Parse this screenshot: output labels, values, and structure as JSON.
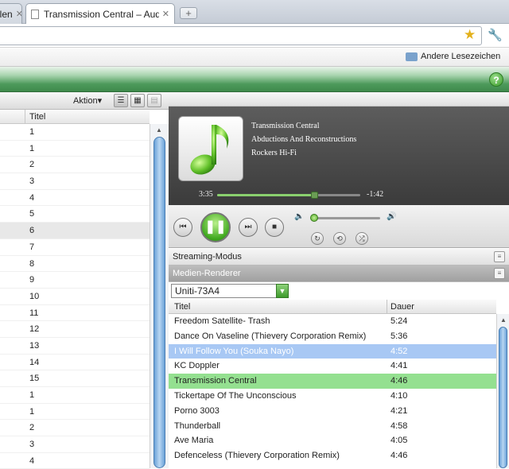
{
  "browser": {
    "tabs": [
      {
        "label": "llen"
      },
      {
        "label": "Transmission Central – Audi"
      }
    ],
    "new_tab": "+",
    "bookmark_folder": "Andere Lesezeichen"
  },
  "left_panel": {
    "action_button": "Aktion",
    "column_header": "Titel",
    "track_numbers": [
      "1",
      "1",
      "2",
      "3",
      "4",
      "5",
      "6",
      "7",
      "8",
      "9",
      "10",
      "11",
      "12",
      "13",
      "14",
      "15",
      "1",
      "1",
      "2",
      "3",
      "4"
    ],
    "selected_index": 6
  },
  "now_playing": {
    "track": "Transmission Central",
    "album": "Abductions And Reconstructions",
    "artist": "Rockers Hi-Fi",
    "elapsed": "3:35",
    "remaining": "-1:42",
    "progress_fraction": 0.68,
    "volume_fraction": 0.02
  },
  "panels": {
    "streaming": "Streaming-Modus",
    "renderer": "Medien-Renderer",
    "renderer_selected": "Uniti-73A4"
  },
  "playlist": {
    "col_title": "Titel",
    "col_duration": "Dauer",
    "rows": [
      {
        "title": "Freedom Satellite- Trash",
        "duration": "5:24"
      },
      {
        "title": "Dance On Vaseline (Thievery Corporation Remix)",
        "duration": "5:36"
      },
      {
        "title": "I Will Follow You (Souka Nayo)",
        "duration": "4:52",
        "state": "selected"
      },
      {
        "title": "KC Doppler",
        "duration": "4:41"
      },
      {
        "title": "Transmission Central",
        "duration": "4:46",
        "state": "playing"
      },
      {
        "title": "Tickertape Of The Unconscious",
        "duration": "4:10"
      },
      {
        "title": "Porno 3003",
        "duration": "4:21"
      },
      {
        "title": "Thunderball",
        "duration": "4:58"
      },
      {
        "title": "Ave Maria",
        "duration": "4:05"
      },
      {
        "title": "Defenceless (Thievery Corporation Remix)",
        "duration": "4:46"
      }
    ]
  },
  "colors": {
    "accent_green": "#3fa81e",
    "selected_row": "#a8c8f4",
    "playing_row": "#94e090"
  },
  "icons": {
    "star": "star-icon",
    "wrench": "wrench-icon",
    "help": "help-icon",
    "folder": "folder-icon"
  }
}
